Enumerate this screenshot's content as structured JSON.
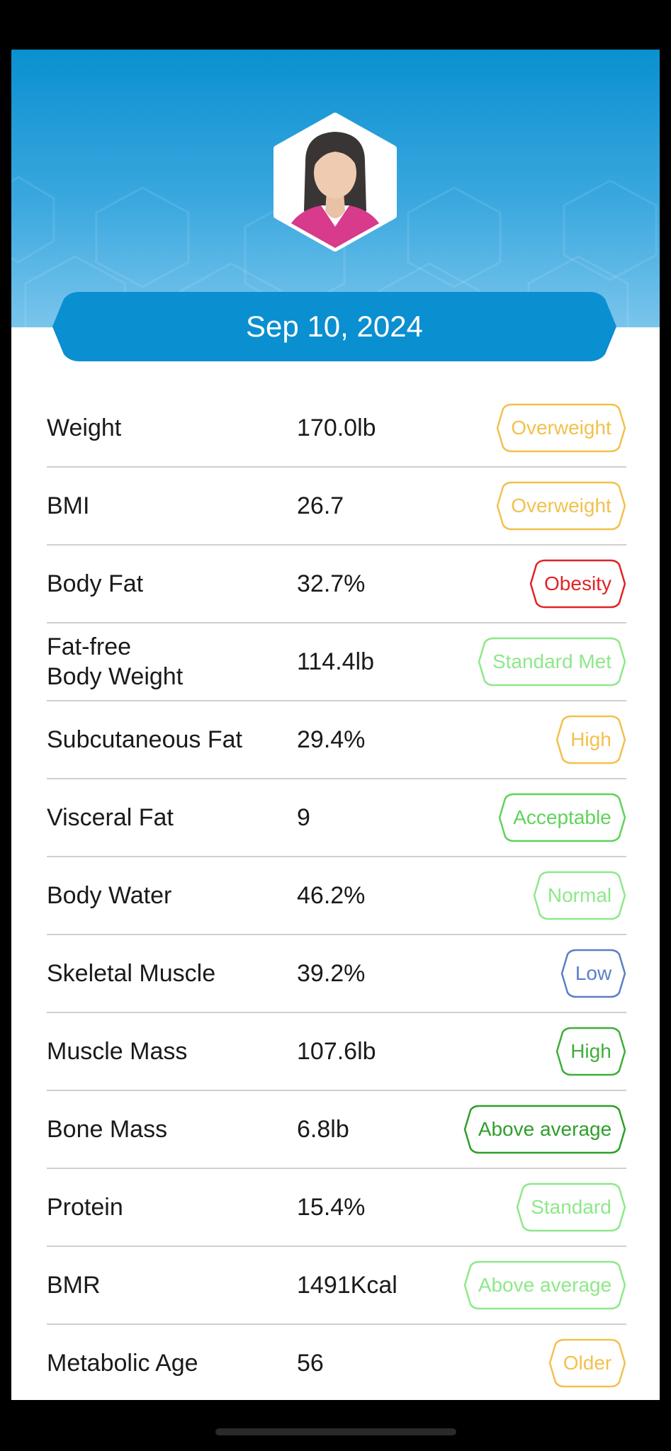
{
  "date": "Sep 10, 2024",
  "avatar": {
    "icon": "female-user-avatar-icon"
  },
  "colors": {
    "header_top": "#0a90d0",
    "header_bottom": "#79c5ec",
    "banner": "#0a8fd1",
    "overweight": "#f2c14e",
    "obesity": "#e02424",
    "standard_met": "#8ee88a",
    "high_yellow": "#f2c14e",
    "acceptable": "#5fd35a",
    "normal": "#8ee88a",
    "low": "#5b7fc4",
    "high_green": "#3fae3a",
    "above_average_dark": "#2f9e2a",
    "standard": "#8ee88a",
    "above_average_light": "#8ee88a",
    "older": "#f2c14e"
  },
  "metrics": [
    {
      "label": "Weight",
      "value": "170.0lb",
      "status": "Overweight",
      "color": "#f2c14e"
    },
    {
      "label": "BMI",
      "value": "26.7",
      "status": "Overweight",
      "color": "#f2c14e"
    },
    {
      "label": "Body Fat",
      "value": "32.7%",
      "status": "Obesity",
      "color": "#e02424"
    },
    {
      "label": "Fat-free\nBody Weight",
      "value": "114.4lb",
      "status": "Standard Met",
      "color": "#8ee88a"
    },
    {
      "label": "Subcutaneous Fat",
      "value": "29.4%",
      "status": "High",
      "color": "#f2c14e"
    },
    {
      "label": "Visceral Fat",
      "value": "9",
      "status": "Acceptable",
      "color": "#5fd35a"
    },
    {
      "label": "Body Water",
      "value": "46.2%",
      "status": "Normal",
      "color": "#8ee88a"
    },
    {
      "label": "Skeletal Muscle",
      "value": "39.2%",
      "status": "Low",
      "color": "#5b7fc4"
    },
    {
      "label": "Muscle Mass",
      "value": "107.6lb",
      "status": "High",
      "color": "#3fae3a"
    },
    {
      "label": "Bone Mass",
      "value": "6.8lb",
      "status": "Above average",
      "color": "#2f9e2a"
    },
    {
      "label": "Protein",
      "value": "15.4%",
      "status": "Standard",
      "color": "#8ee88a"
    },
    {
      "label": "BMR",
      "value": "1491Kcal",
      "status": "Above average",
      "color": "#8ee88a"
    },
    {
      "label": "Metabolic Age",
      "value": "56",
      "status": "Older",
      "color": "#f2c14e"
    }
  ]
}
